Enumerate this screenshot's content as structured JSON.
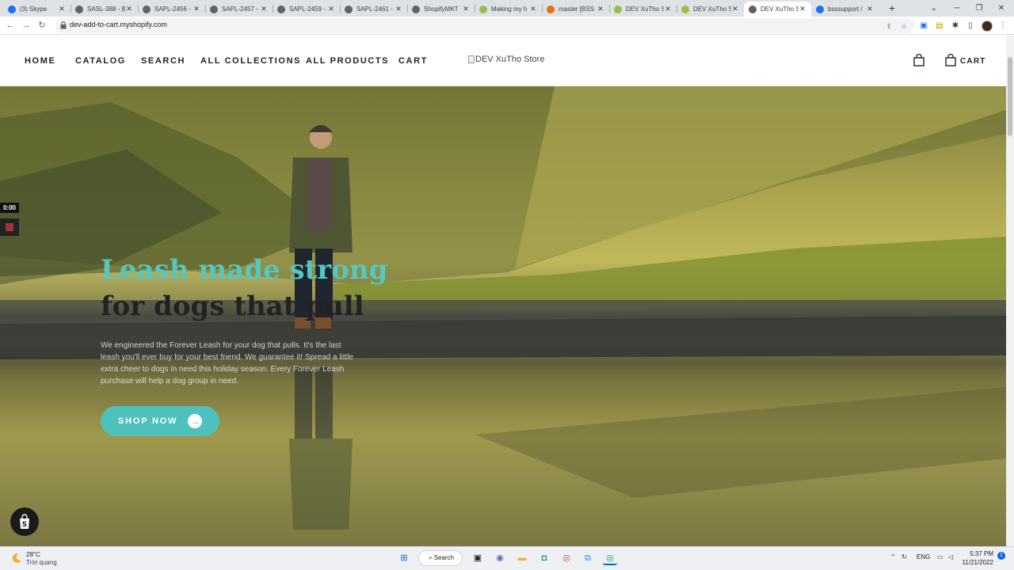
{
  "browser": {
    "tabs": [
      {
        "title": "(3) Skype",
        "favicon_color": "#1a73e8",
        "active": false
      },
      {
        "title": "SASL-388 - B",
        "favicon_color": "#5f6368",
        "active": false
      },
      {
        "title": "SAPL-2456 -",
        "favicon_color": "#5f6368",
        "active": false
      },
      {
        "title": "SAPL-2457 -",
        "favicon_color": "#5f6368",
        "active": false
      },
      {
        "title": "SAPL-2459 -",
        "favicon_color": "#5f6368",
        "active": false
      },
      {
        "title": "SAPL-2461 -",
        "favicon_color": "#5f6368",
        "active": false
      },
      {
        "title": "ShopifyMKT",
        "favicon_color": "#5f6368",
        "active": false
      },
      {
        "title": "Making my h",
        "favicon_color": "#95bf47",
        "active": false
      },
      {
        "title": "master [BSS",
        "favicon_color": "#e37400",
        "active": false
      },
      {
        "title": "DEV XuTho S",
        "favicon_color": "#95bf47",
        "active": false
      },
      {
        "title": "DEV XuTho S",
        "favicon_color": "#95bf47",
        "active": false
      },
      {
        "title": "DEV XuTho S",
        "favicon_color": "#5f6368",
        "active": true
      },
      {
        "title": "bsssupport /",
        "favicon_color": "#1a73e8",
        "active": false
      }
    ],
    "url": "dev-add-to-cart.myshopify.com"
  },
  "store": {
    "nav": [
      "HOME",
      "CATALOG",
      "SEARCH",
      "ALL COLLECTIONS",
      "ALL PRODUCTS",
      "CART"
    ],
    "logo_alt": "DEV XuTho Store",
    "cart_label": "CART"
  },
  "hero": {
    "headline_line1": "Leash made strong",
    "headline_line2": "for dogs that pull",
    "body": "We engineered the Forever Leash for your dog that pulls. It's the last leash you'll ever buy for your best friend. We guarantee it! Spread a little extra cheer to dogs in need this holiday season. Every Forever Leash purchase will help a dog group in need.",
    "cta_label": "SHOP NOW",
    "accent_color": "#55c7c1"
  },
  "recorder": {
    "time": "0:00"
  },
  "taskbar": {
    "weather_temp": "28°C",
    "weather_desc": "Trời quang",
    "search_label": "Search",
    "language": "ENG",
    "time": "5:37 PM",
    "date": "11/21/2022"
  }
}
